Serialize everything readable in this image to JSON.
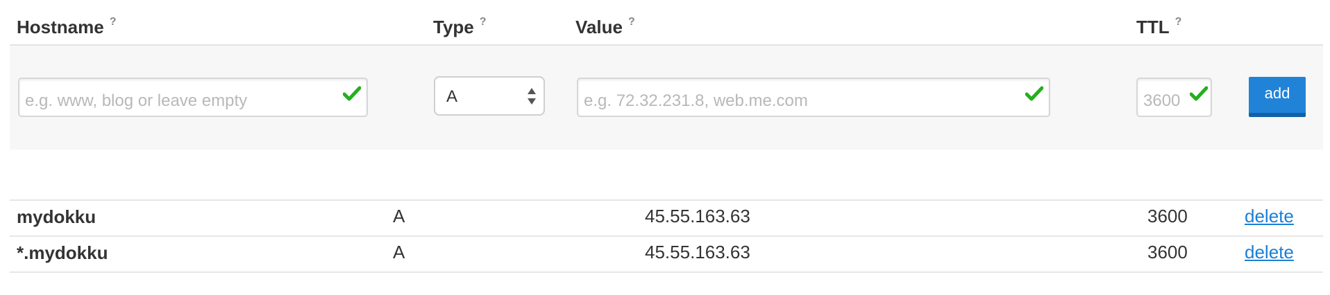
{
  "header": {
    "hostname": "Hostname",
    "type": "Type",
    "value": "Value",
    "ttl": "TTL",
    "help_mark": "?"
  },
  "form": {
    "hostname_placeholder": "e.g. www, blog or leave empty",
    "type_selected": "A",
    "value_placeholder": "e.g. 72.32.231.8, web.me.com",
    "ttl_placeholder": "3600",
    "add_label": "add"
  },
  "records": [
    {
      "hostname": "mydokku",
      "type": "A",
      "value": "45.55.163.63",
      "ttl": "3600",
      "action": "delete"
    },
    {
      "hostname": "*.mydokku",
      "type": "A",
      "value": "45.55.163.63",
      "ttl": "3600",
      "action": "delete"
    }
  ],
  "colors": {
    "check": "#23b01c",
    "button": "#2183d8",
    "link": "#1a7fd4"
  }
}
